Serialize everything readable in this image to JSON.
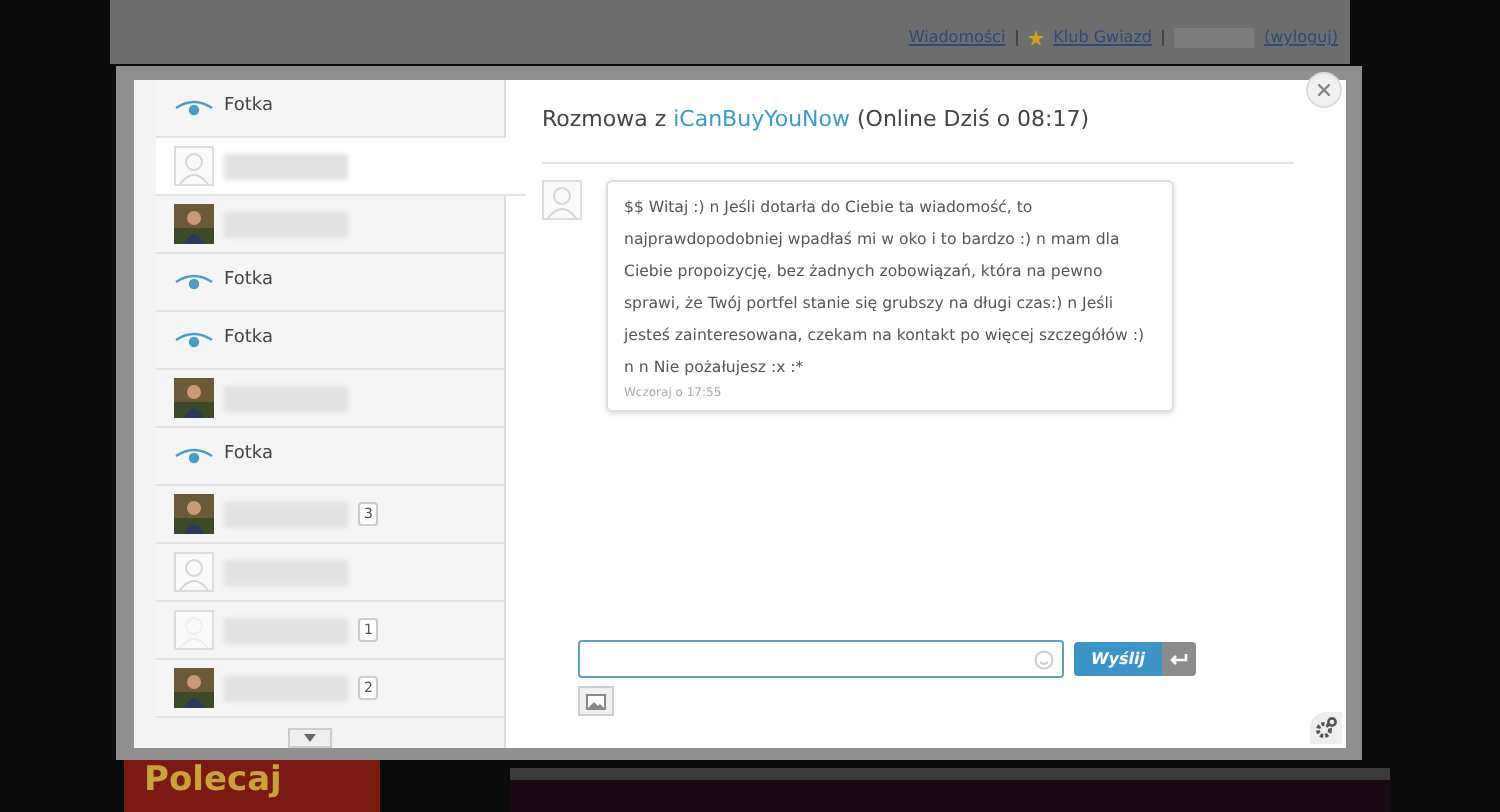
{
  "header_links": [
    {
      "label": "Wiadomości",
      "kind": "link"
    },
    {
      "label": "Klub Gwiazd",
      "kind": "star-link"
    },
    {
      "label": "(wyloguj)",
      "kind": "link"
    }
  ],
  "promo": {
    "label": "Polecaj"
  },
  "contacts": [
    {
      "kind": "fotka",
      "label": "Fotka",
      "selected": false
    },
    {
      "kind": "user",
      "selected": true
    },
    {
      "kind": "photo-user",
      "selected": false
    },
    {
      "kind": "fotka",
      "label": "Fotka",
      "selected": false
    },
    {
      "kind": "fotka",
      "label": "Fotka",
      "selected": false
    },
    {
      "kind": "photo-user",
      "selected": false
    },
    {
      "kind": "fotka",
      "label": "Fotka",
      "selected": false
    },
    {
      "kind": "photo-user",
      "badge": "3",
      "selected": false
    },
    {
      "kind": "user",
      "selected": false
    },
    {
      "kind": "faded-user",
      "badge": "1",
      "selected": false
    },
    {
      "kind": "photo-user",
      "badge": "2",
      "selected": false
    }
  ],
  "chat": {
    "title_prefix": "Rozmowa z",
    "username": "iCanBuyYouNow",
    "status": "(Online Dziś o 08:17)",
    "messages": [
      {
        "text": "$$ Witaj :) n Jeśli dotarła do Ciebie ta wiadomość, to najprawdopodobniej wpadłaś mi w oko i to bardzo :) n mam dla Ciebie propoizycję, bez żadnych zobowiązań, która na pewno sprawi, że Twój portfel stanie się grubszy na długi czas:) n Jeśli jesteś zainteresowana, czekam na kontakt po więcej szczegółów :) n n Nie pożałujesz :x :*",
        "time": "Wczoraj o 17:55"
      }
    ],
    "send_label": "Wyślij"
  }
}
